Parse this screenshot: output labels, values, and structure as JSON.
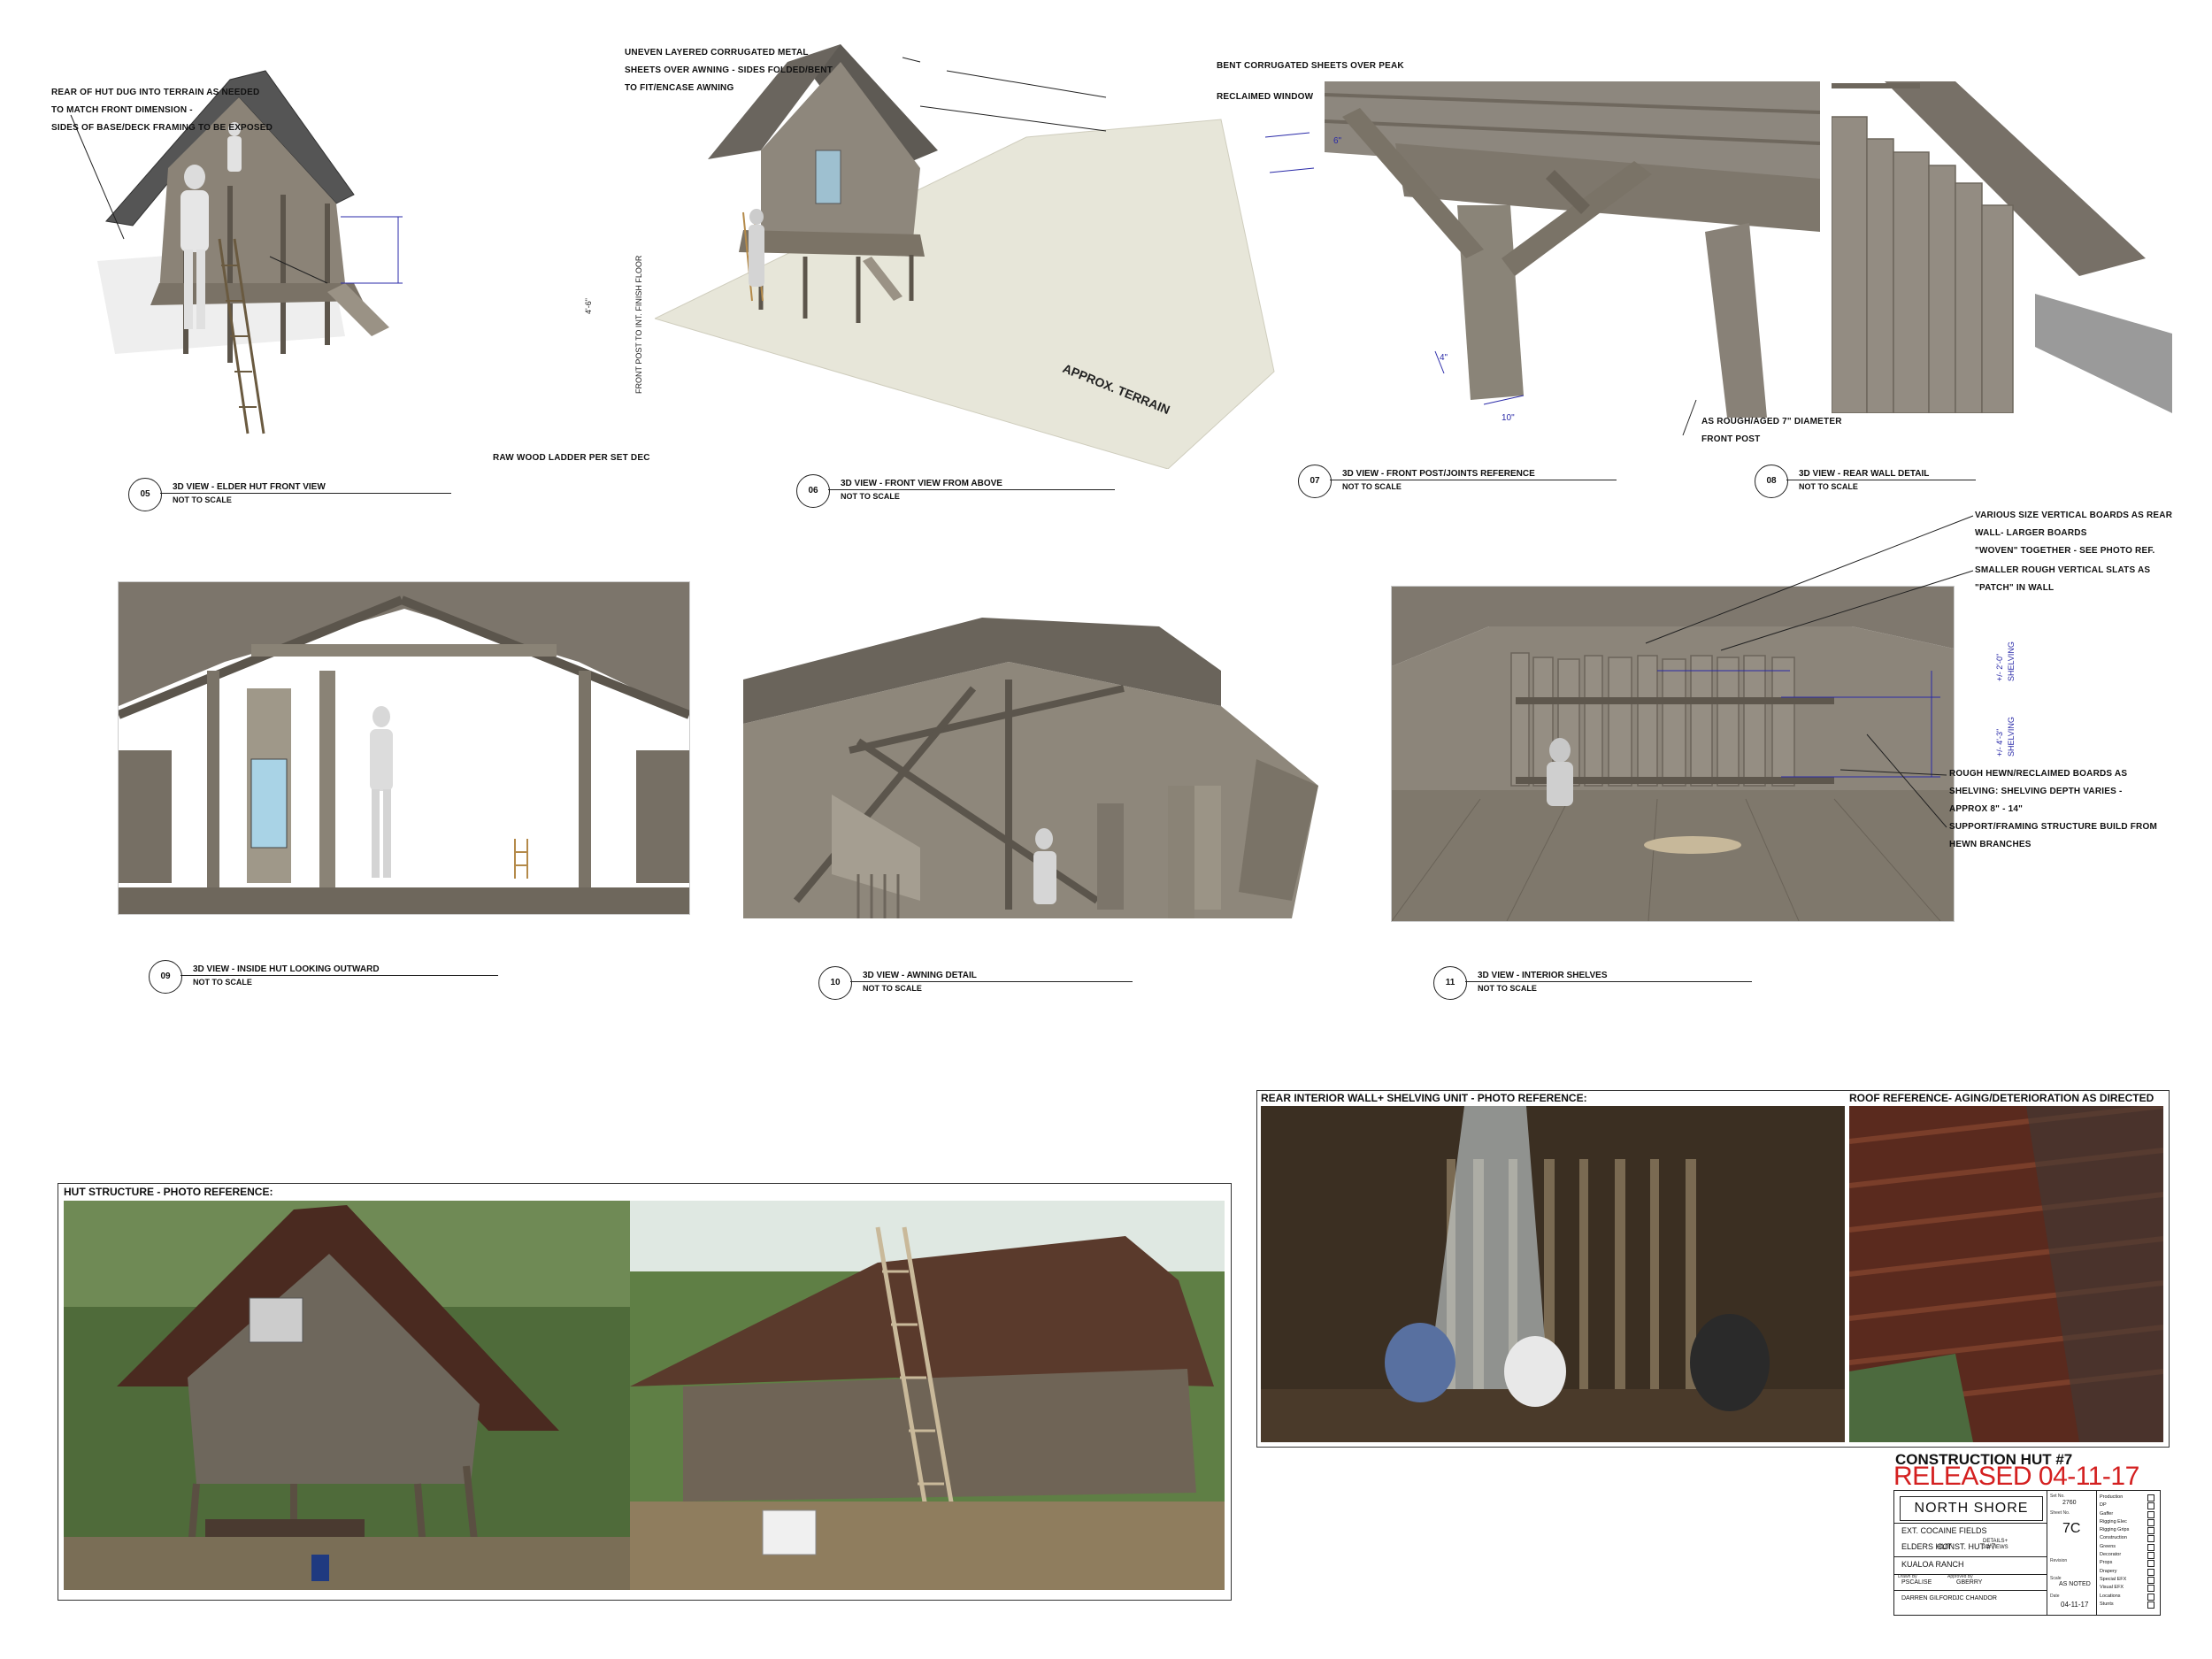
{
  "views": [
    {
      "number": "05",
      "title": "3D VIEW - ELDER HUT FRONT VIEW",
      "subtitle": "NOT TO SCALE"
    },
    {
      "number": "06",
      "title": "3D VIEW - FRONT VIEW FROM ABOVE",
      "subtitle": "NOT TO SCALE"
    },
    {
      "number": "07",
      "title": "3D VIEW - FRONT POST/JOINTS REFERENCE",
      "subtitle": "NOT TO SCALE"
    },
    {
      "number": "08",
      "title": "3D VIEW - REAR WALL DETAIL",
      "subtitle": "NOT TO SCALE"
    },
    {
      "number": "09",
      "title": "3D VIEW - INSIDE HUT LOOKING OUTWARD",
      "subtitle": "NOT TO SCALE"
    },
    {
      "number": "10",
      "title": "3D VIEW - AWNING DETAIL",
      "subtitle": "NOT TO SCALE"
    },
    {
      "number": "11",
      "title": "3D VIEW - INTERIOR SHELVES",
      "subtitle": "NOT TO SCALE"
    }
  ],
  "notes": {
    "rear_dug": "REAR OF HUT DUG INTO TERRAIN AS NEEDED\nTO MATCH FRONT DIMENSION -\nSIDES OF BASE/DECK FRAMING TO BE EXPOSED",
    "ladder": "RAW WOOD LADDER PER SET DEC",
    "floor_dim_a": "4'-6\"",
    "floor_dim_b": "FRONT POST TO INT. FINISH FLOOR",
    "corrugated": "UNEVEN LAYERED CORRUGATED METAL\nSHEETS OVER AWNING - SIDES FOLDED/BENT\nTO FIT/ENCASE AWNING",
    "bent_peak": "BENT CORRUGATED SHEETS OVER PEAK",
    "window": "RECLAIMED WINDOW",
    "terrain": "APPROX. TERRAIN",
    "post_dim_a": "4\"",
    "post_dim_b": "10\"",
    "post_dim_c": "6\"",
    "post_note": "AS ROUGH/AGED 7\" DIAMETER\nFRONT POST",
    "boards": "VARIOUS SIZE VERTICAL BOARDS AS REAR\nWALL- LARGER BOARDS\n\"WOVEN\" TOGETHER - SEE PHOTO REF.",
    "slats": "SMALLER ROUGH VERTICAL SLATS AS\n\"PATCH\" IN WALL",
    "shelving_note": "ROUGH HEWN/RECLAIMED BOARDS AS\nSHELVING: SHELVING DEPTH VARIES -\nAPPROX 8\" - 14\"",
    "support_note": "SUPPORT/FRAMING STRUCTURE BUILD FROM\nHEWN BRANCHES",
    "shelf_dim_a": "+/- 2'-0\"",
    "shelf_dim_a2": "SHELVING",
    "shelf_dim_b": "+/- 4'-3\"",
    "shelf_dim_b2": "SHELVING"
  },
  "photo_refs": {
    "hut_structure": "HUT STRUCTURE - PHOTO REFERENCE:",
    "rear_wall": "REAR INTERIOR WALL+ SHELVING UNIT - PHOTO REFERENCE:",
    "roof": "ROOF REFERENCE-  AGING/DETERIORATION AS DIRECTED"
  },
  "release": {
    "project_line": "CONSTRUCTION HUT #7",
    "released": "RELEASED 04-11-17"
  },
  "title_block": {
    "show": "NORTH SHORE",
    "set": "EXT. COCAINE FIELDS",
    "name": "ELDERS HUT",
    "const": "CONST. HUT #7",
    "details": "DETAILS+\n3D VIEWS",
    "location": "KUALOA RANCH",
    "drawn_by": "PSCALISE",
    "approved_by": "GBERRY",
    "scale": "AS NOTED",
    "designer": "DARREN GILFORD",
    "director": "JC CHANDOR",
    "date": "04-11-17",
    "set_no": "2760",
    "sheet_no": "7C",
    "dept_list": [
      "Production",
      "DP",
      "Gaffer",
      "Rigging Elec",
      "Rigging Grips",
      "Construction",
      "Greens",
      "Decorator",
      "Props",
      "Drapery",
      "Special EFX",
      "Visual EFX",
      "Locations",
      "Stunts"
    ]
  },
  "colors": {
    "dimension": "#2a2aa8",
    "release_red": "#d42020"
  }
}
